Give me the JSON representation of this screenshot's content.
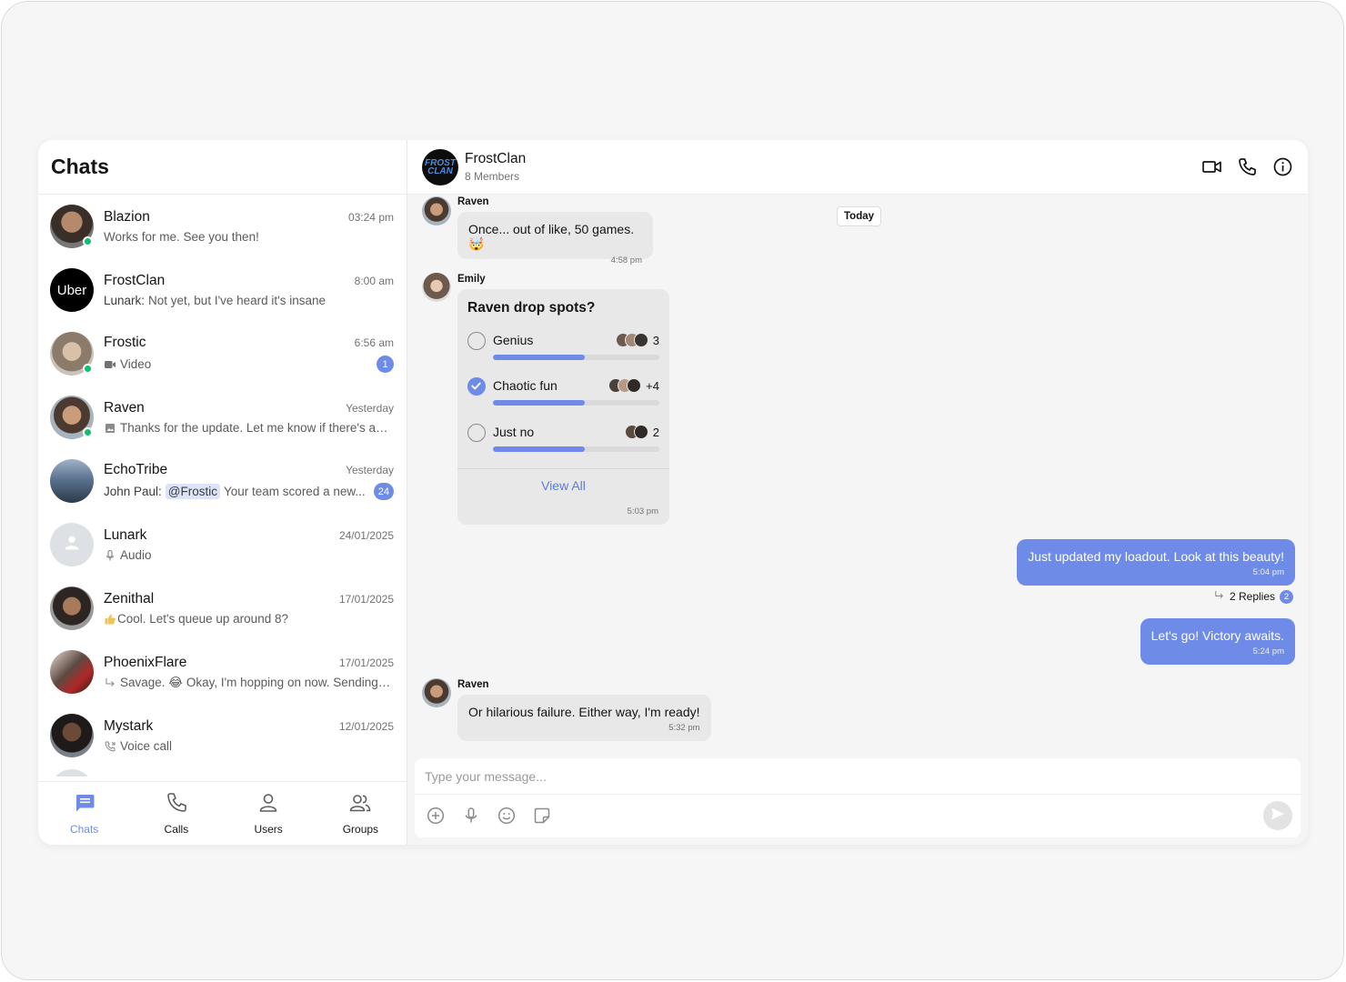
{
  "sidebar": {
    "title": "Chats",
    "chats": [
      {
        "name": "Blazion",
        "time": "03:24 pm",
        "preview": "Works for me. See you then!",
        "online": true
      },
      {
        "name": "FrostClan",
        "time": "8:00 am",
        "sender": "Lunark:",
        "preview": "Not yet, but I've heard it's insane",
        "avatar_text": "Uber"
      },
      {
        "name": "Frostic",
        "time": "6:56 am",
        "preview": "Video",
        "preview_icon": "video-icon",
        "unread": "1",
        "online": true
      },
      {
        "name": "Raven",
        "time": "Yesterday",
        "preview": "Thanks for the update. Let me know if there's any...",
        "preview_icon": "image-icon",
        "online": true
      },
      {
        "name": "EchoTribe",
        "time": "Yesterday",
        "sender": "John Paul:",
        "mention": "@Frostic",
        "preview": "Your team scored a new...",
        "unread": "24"
      },
      {
        "name": "Lunark",
        "time": "24/01/2025",
        "preview": "Audio",
        "preview_icon": "mic-icon"
      },
      {
        "name": "Zenithal",
        "time": "17/01/2025",
        "preview": "Cool. Let's queue up around 8?",
        "preview_icon": "thumbs-up-icon"
      },
      {
        "name": "PhoenixFlare",
        "time": "17/01/2025",
        "preview": "Savage. 😂 Okay, I'm hopping on now. Sending invite...",
        "preview_icon": "reply-icon"
      },
      {
        "name": "Mystark",
        "time": "12/01/2025",
        "preview": "Voice call",
        "preview_icon": "phone-call-icon"
      }
    ]
  },
  "nav": {
    "chats": "Chats",
    "calls": "Calls",
    "users": "Users",
    "groups": "Groups"
  },
  "header": {
    "name": "FrostClan",
    "members": "8 Members",
    "logo_line1": "FROST",
    "logo_line2": "CLAN"
  },
  "messages": {
    "today": "Today",
    "m1": {
      "sender": "Raven",
      "text": "Once... out of like, 50 games. 🤯",
      "time": "4:58 pm"
    },
    "poll": {
      "sender": "Emily",
      "question": "Raven drop spots?",
      "options": [
        {
          "label": "Genius",
          "count": "3",
          "fill": 0.55,
          "checked": false
        },
        {
          "label": "Chaotic fun",
          "count": "+4",
          "fill": 0.55,
          "checked": true
        },
        {
          "label": "Just no",
          "count": "2",
          "fill": 0.55,
          "checked": false
        }
      ],
      "view_all": "View All",
      "time": "5:03 pm"
    },
    "m3": {
      "text": "Just updated my loadout. Look at this beauty!",
      "time": "5:04 pm"
    },
    "replies": {
      "label": "2 Replies",
      "count": "2"
    },
    "m4": {
      "text": "Let's go! Victory awaits.",
      "time": "5:24 pm"
    },
    "m5": {
      "sender": "Raven",
      "text": "Or hilarious failure. Either way, I'm ready!",
      "time": "5:32 pm"
    }
  },
  "composer": {
    "placeholder": "Type your message..."
  },
  "colors": {
    "accent": "#6f8be8",
    "online": "#09c26f"
  }
}
